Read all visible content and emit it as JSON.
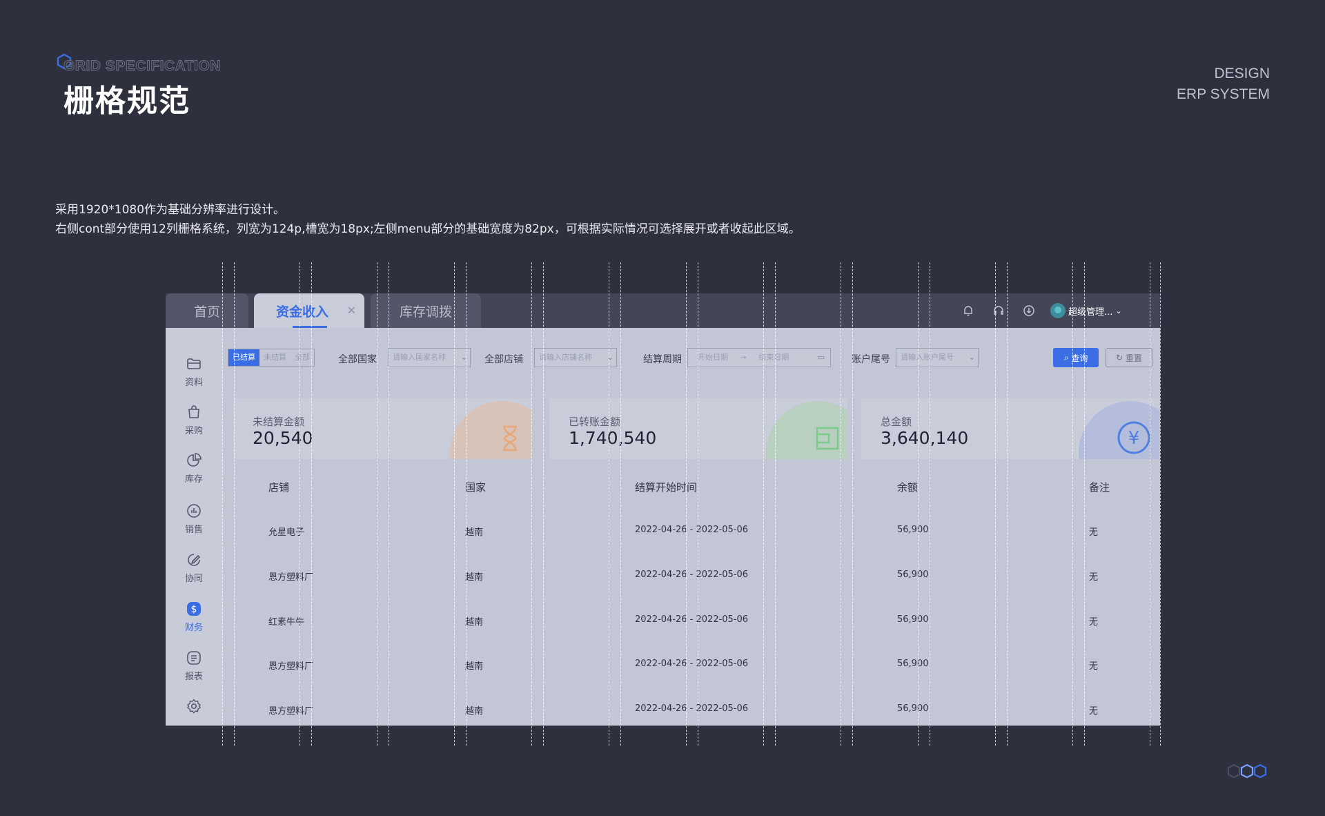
{
  "header": {
    "eyebrow": "GRID SPECIFICATION",
    "title": "栅格规范",
    "right_line1": "DESIGN",
    "right_line2": "ERP SYSTEM"
  },
  "description": {
    "line1": "采用1920*1080作为基础分辨率进行设计。",
    "line2": "右侧cont部分使用12列栅格系统，列宽为124p,槽宽为18px;左侧menu部分的基础宽度为82px，可根据实际情况可选择展开或者收起此区域。"
  },
  "tabs": [
    {
      "label": "首页"
    },
    {
      "label": "资金收入"
    },
    {
      "label": "库存调拨"
    }
  ],
  "topbar": {
    "icons": [
      "bell-icon",
      "headset-icon",
      "download-icon"
    ],
    "user": "超级管理..."
  },
  "sidemenu": [
    {
      "label": "资料",
      "icon": "folder-icon"
    },
    {
      "label": "采购",
      "icon": "bag-icon"
    },
    {
      "label": "库存",
      "icon": "pie-chart-icon"
    },
    {
      "label": "销售",
      "icon": "bar-chart-icon"
    },
    {
      "label": "协同",
      "icon": "edit-icon"
    },
    {
      "label": "财务",
      "icon": "dollar-icon"
    },
    {
      "label": "报表",
      "icon": "list-icon"
    },
    {
      "label": "",
      "icon": "gear-icon"
    }
  ],
  "filters": {
    "segments": [
      "已结算",
      "未结算",
      "全部"
    ],
    "country_label": "全部国家",
    "country_placeholder": "请输入国家名称",
    "store_label": "全部店铺",
    "store_placeholder": "请输入店铺名称",
    "period_label": "结算周期",
    "period_start": "开始日期",
    "period_end": "结束日期",
    "account_label": "账户尾号",
    "account_placeholder": "请输入账户尾号",
    "query_button": "查询",
    "reset_button": "重置"
  },
  "cards": [
    {
      "label": "未结算金额",
      "value": "20,540",
      "color": "#e6a87c"
    },
    {
      "label": "已转账金额",
      "value": "1,740,540",
      "color": "#7dcc8d"
    },
    {
      "label": "总金额",
      "value": "3,640,140",
      "color": "#4f7fe0"
    }
  ],
  "table": {
    "columns": [
      "店铺",
      "国家",
      "结算开始时间",
      "余额",
      "备注"
    ],
    "rows": [
      [
        "允星电子",
        "越南",
        "2022-04-26  -  2022-05-06",
        "56,900",
        "无"
      ],
      [
        "恩方塑料厂",
        "越南",
        "2022-04-26  -  2022-05-06",
        "56,900",
        "无"
      ],
      [
        "红素牛牛",
        "越南",
        "2022-04-26  -  2022-05-06",
        "56,900",
        "无"
      ],
      [
        "恩方塑料厂",
        "越南",
        "2022-04-26  -  2022-05-06",
        "56,900",
        "无"
      ],
      [
        "恩方塑料厂",
        "越南",
        "2022-04-26  -  2022-05-06",
        "56,900",
        "无"
      ]
    ]
  },
  "colors": {
    "background": "#2e303e",
    "accent": "#3b6ee4"
  }
}
